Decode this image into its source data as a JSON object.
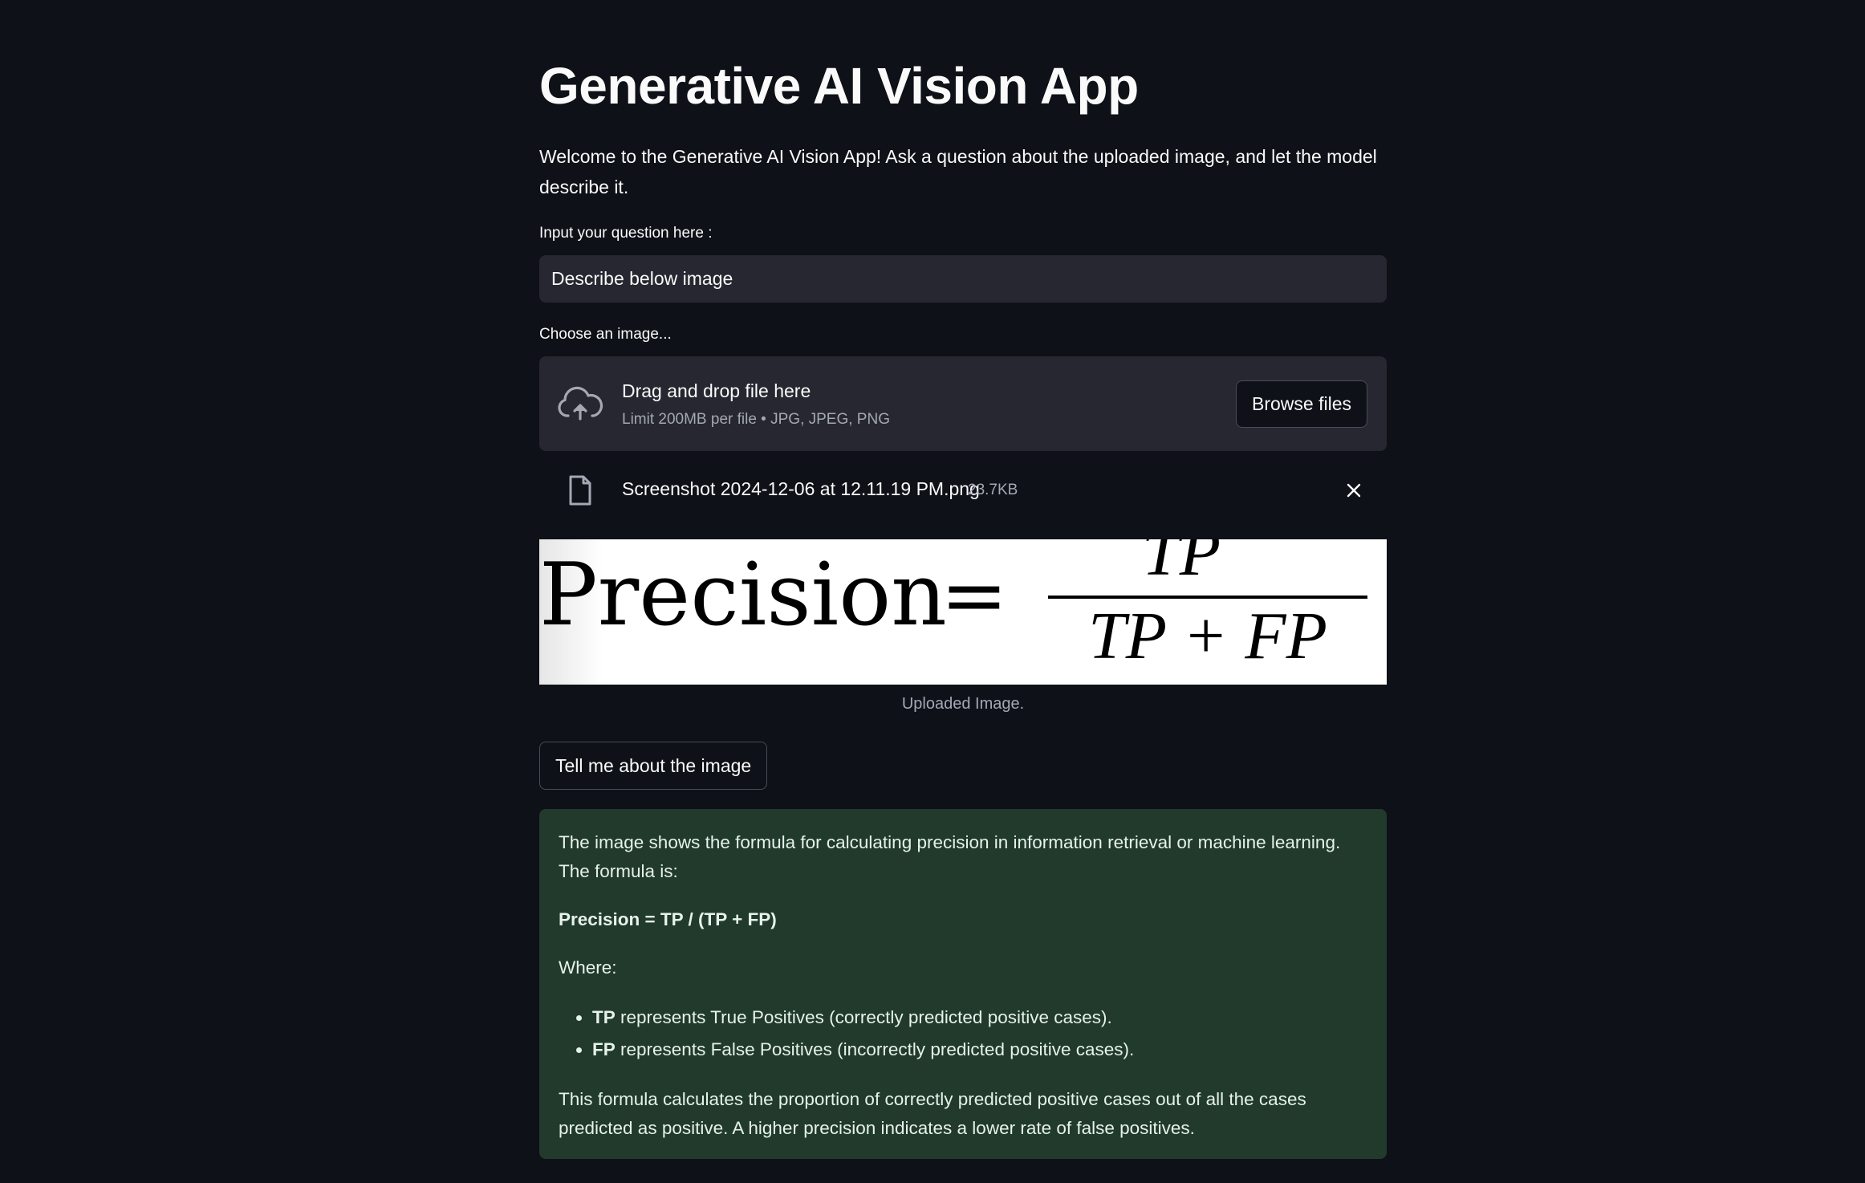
{
  "app": {
    "title": "Generative AI Vision App",
    "intro": "Welcome to the Generative AI Vision App! Ask a question about the uploaded image, and let the model describe it."
  },
  "question": {
    "label": "Input your question here :",
    "value": "Describe below image"
  },
  "uploader": {
    "label": "Choose an image...",
    "drop_title": "Drag and drop file here",
    "drop_limit": "Limit 200MB per file • JPG, JPEG, PNG",
    "browse_label": "Browse files",
    "icon": "cloud-upload-icon"
  },
  "file": {
    "name": "Screenshot 2024-12-06 at 12.11.19 PM.png",
    "size": "23.7KB",
    "icon": "file-icon",
    "remove_icon": "close-icon"
  },
  "image": {
    "lhs": "Precision",
    "equals": "=",
    "numerator": "TP",
    "denominator": "TP + FP",
    "caption": "Uploaded Image."
  },
  "action": {
    "button_label": "Tell me about the image"
  },
  "response": {
    "intro": "The image shows the formula for calculating precision in information retrieval or machine learning. The formula is:",
    "formula": "Precision = TP / (TP + FP)",
    "where": "Where:",
    "bullets": [
      {
        "term": "TP",
        "text": " represents True Positives (correctly predicted positive cases)."
      },
      {
        "term": "FP",
        "text": " represents False Positives (incorrectly predicted positive cases)."
      }
    ],
    "conclusion": "This formula calculates the proportion of correctly predicted positive cases out of all the cases predicted as positive. A higher precision indicates a lower rate of false positives."
  },
  "colors": {
    "background": "#0e1117",
    "surface": "#262730",
    "success_bg": "#213a2c",
    "text": "#fafafa",
    "muted": "#a3a8b4"
  }
}
